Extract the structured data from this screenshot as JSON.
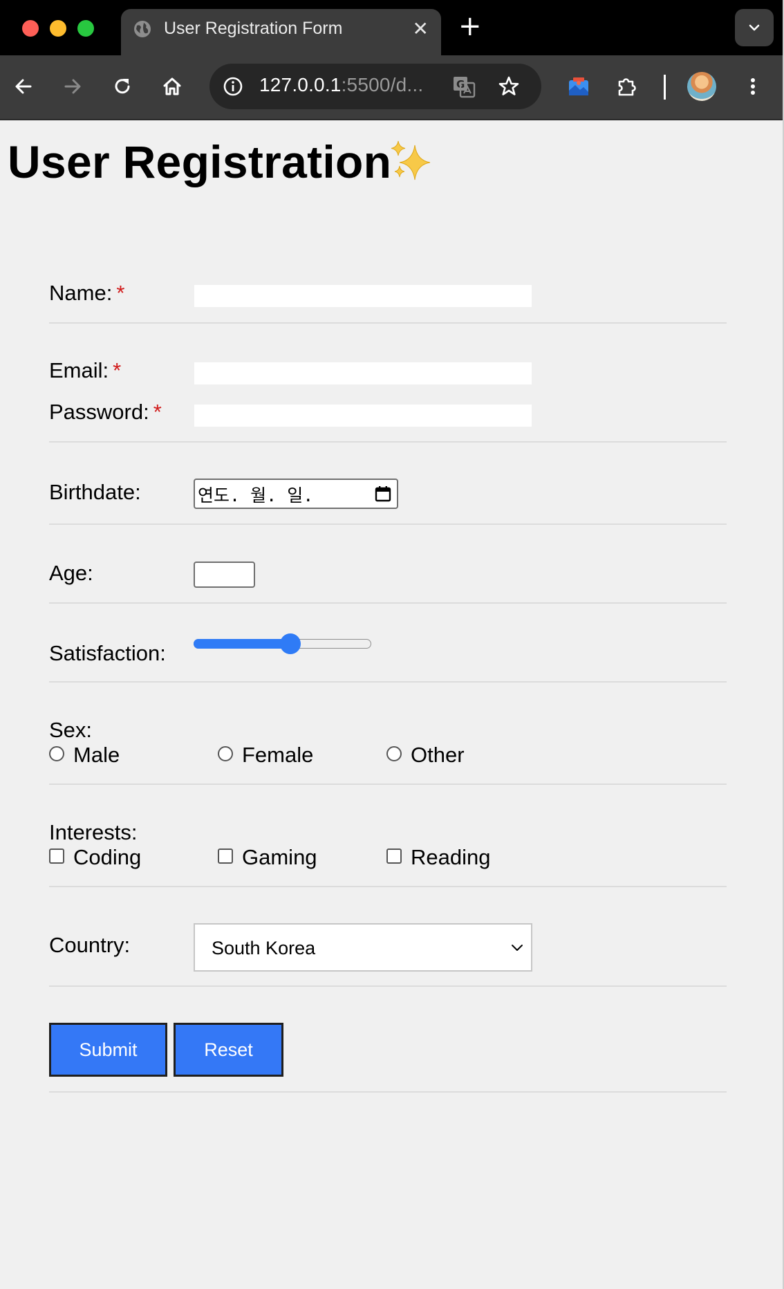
{
  "browser": {
    "tab_title": "User Registration Form",
    "url_host": "127.0.0.1",
    "url_rest": ":5500/d..."
  },
  "page": {
    "title": "User Registration",
    "title_emoji": "sparkles-icon"
  },
  "form": {
    "name_label": "Name:",
    "email_label": "Email:",
    "password_label": "Password:",
    "required_mark": "*",
    "name_value": "",
    "email_value": "",
    "password_value": "",
    "birthdate_label": "Birthdate:",
    "birthdate_placeholder": "연도. 월. 일.",
    "age_label": "Age:",
    "age_value": "",
    "satisfaction_label": "Satisfaction:",
    "satisfaction_value_fraction": 0.55,
    "sex_label": "Sex:",
    "sex_options": [
      "Male",
      "Female",
      "Other"
    ],
    "interests_label": "Interests:",
    "interest_options": [
      "Coding",
      "Gaming",
      "Reading"
    ],
    "country_label": "Country:",
    "country_selected": "South Korea",
    "submit_label": "Submit",
    "reset_label": "Reset"
  },
  "colors": {
    "accent": "#3478f6",
    "required": "#d11a1a",
    "page_bg": "#f0f0f0"
  }
}
